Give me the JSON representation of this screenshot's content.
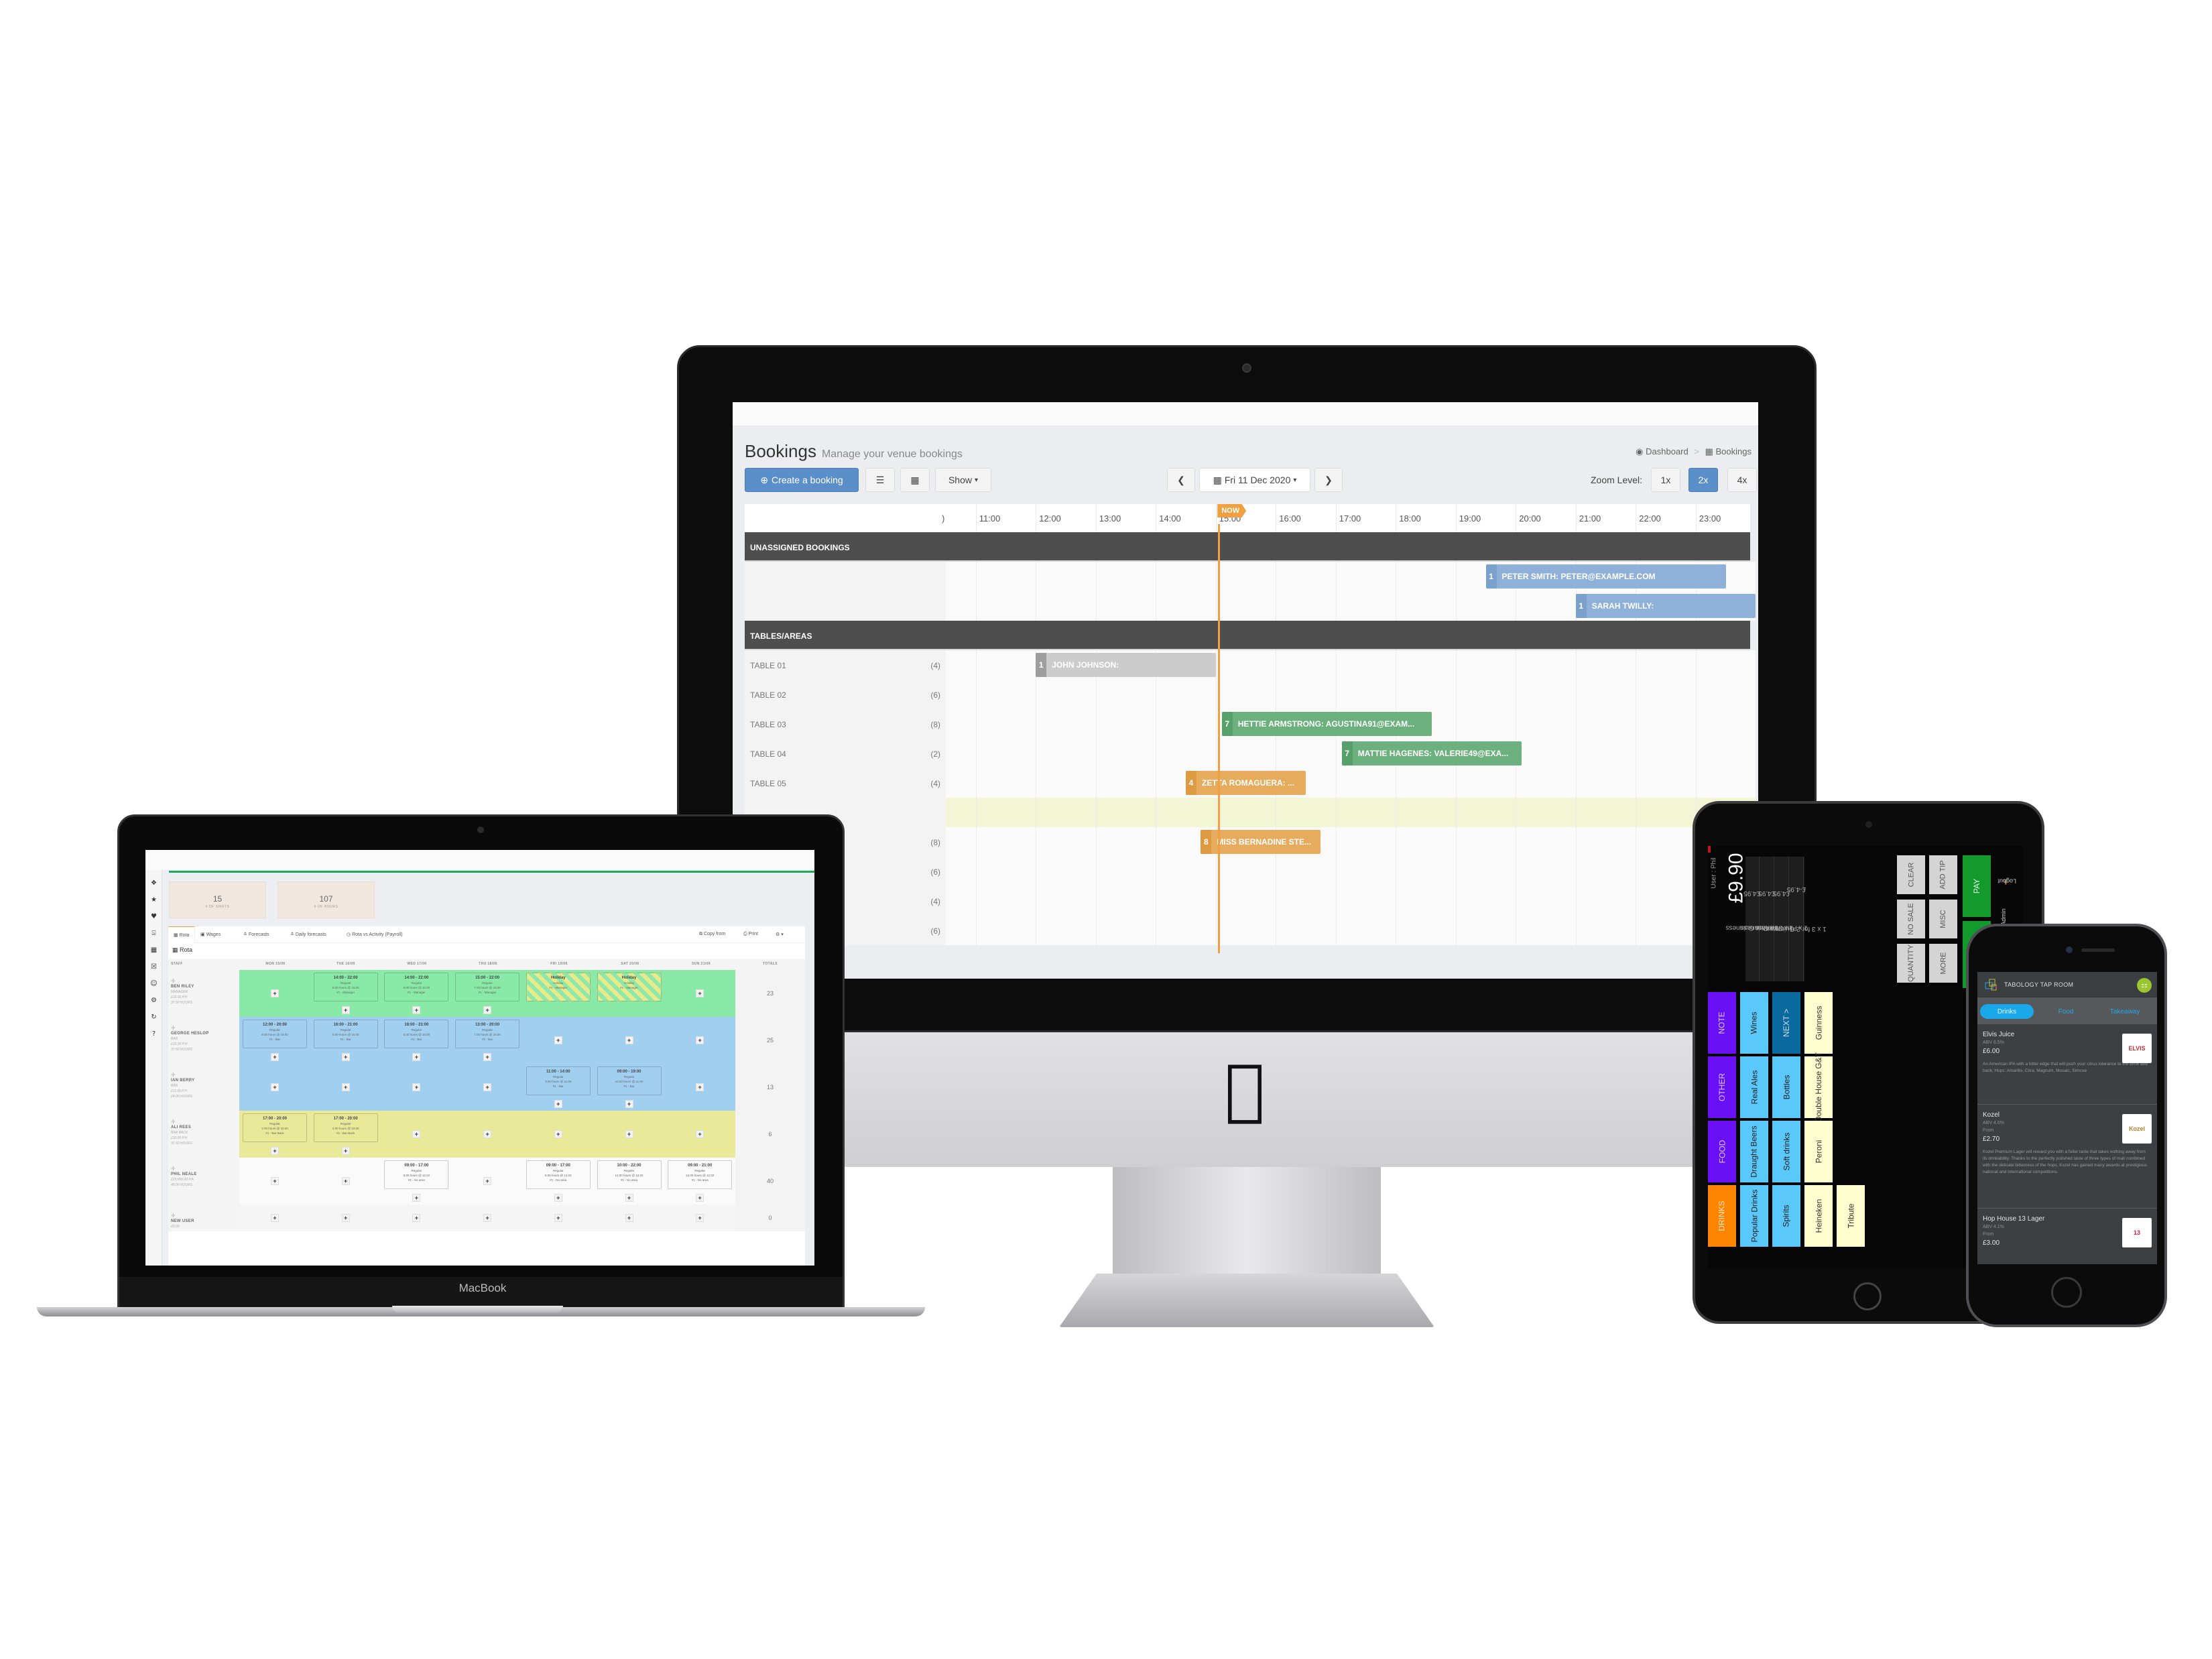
{
  "imac": {
    "logo_icon": "apple-logo-icon",
    "bookings": {
      "title": "Bookings",
      "subtitle": "Manage your venue bookings",
      "breadcrumb": [
        {
          "icon": "dashboard-icon",
          "label": "Dashboard"
        },
        {
          "icon": "calendar-icon",
          "label": "Bookings"
        }
      ],
      "toolbar": {
        "create_label": "Create a booking",
        "list_view_icon": "list-icon",
        "calendar_view_icon": "calendar-icon",
        "show_label": "Show",
        "prev_icon": "chevron-left-icon",
        "date_label": "Fri 11 Dec 2020",
        "next_icon": "chevron-right-icon",
        "zoom_label": "Zoom Level:",
        "zoom_levels": [
          "1x",
          "2x",
          "4x"
        ],
        "zoom_selected": "2x"
      },
      "timeline": {
        "hours": [
          "11:00",
          "12:00",
          "13:00",
          "14:00",
          "15:00",
          "16:00",
          "17:00",
          "18:00",
          "19:00",
          "20:00",
          "21:00",
          "22:00",
          "23:00"
        ],
        "partial_hour_label": ")",
        "now_label": "NOW",
        "now_time": 15.05,
        "sections": [
          {
            "title": "UNASSIGNED BOOKINGS",
            "rows": [
              {
                "label": "",
                "capacity": "",
                "bookings": [
                  {
                    "covers": "1",
                    "name": "PETER SMITH: PETER@EXAMPLE.COM",
                    "start": 19.5,
                    "end": 23.5,
                    "color": "#8fb0d8",
                    "accent": "#7aa0cc"
                  }
                ]
              },
              {
                "label": "",
                "capacity": "",
                "bookings": [
                  {
                    "covers": "1",
                    "name": "SARAH TWILLY:",
                    "start": 21.0,
                    "end": 24.0,
                    "color": "#8fb0d8",
                    "accent": "#7aa0cc"
                  }
                ]
              }
            ]
          },
          {
            "title": "TABLES/AREAS",
            "rows": [
              {
                "label": "TABLE 01",
                "capacity": "(4)",
                "bookings": [
                  {
                    "covers": "1",
                    "name": "JOHN JOHNSON:",
                    "start": 12.0,
                    "end": 15.0,
                    "color": "#cccccc",
                    "accent": "#9e9e9e"
                  }
                ]
              },
              {
                "label": "TABLE 02",
                "capacity": "(6)",
                "bookings": []
              },
              {
                "label": "TABLE 03",
                "capacity": "(8)",
                "bookings": [
                  {
                    "covers": "7",
                    "name": "HETTIE ARMSTRONG: AGUSTINA91@EXAM...",
                    "start": 15.1,
                    "end": 18.6,
                    "color": "#6cb07e",
                    "accent": "#57a06a"
                  }
                ]
              },
              {
                "label": "TABLE 04",
                "capacity": "(2)",
                "bookings": [
                  {
                    "covers": "7",
                    "name": "MATTIE HAGENES: VALERIE49@EXA...",
                    "start": 17.1,
                    "end": 20.1,
                    "color": "#6cb07e",
                    "accent": "#57a06a"
                  }
                ]
              },
              {
                "label": "TABLE 05",
                "capacity": "(4)",
                "bookings": [
                  {
                    "covers": "4",
                    "name": "ZETTA ROMAGUERA: ...",
                    "start": 14.5,
                    "end": 16.5,
                    "color": "#e6ab5c",
                    "accent": "#de9a40"
                  }
                ]
              },
              {
                "label": "",
                "capacity": "",
                "highlight": true,
                "bookings": []
              },
              {
                "label": "",
                "capacity": "(8)",
                "bookings": [
                  {
                    "covers": "8",
                    "name": "MISS BERNADINE STE...",
                    "start": 14.75,
                    "end": 16.75,
                    "color": "#e6ab5c",
                    "accent": "#de9a40"
                  }
                ]
              },
              {
                "label": "",
                "capacity": "(6)",
                "bookings": []
              },
              {
                "label": "",
                "capacity": "(4)",
                "bookings": []
              },
              {
                "label": "",
                "capacity": "(6)",
                "bookings": []
              }
            ]
          }
        ]
      }
    }
  },
  "macbook": {
    "label": "MacBook",
    "sidebar_icons": [
      "cubes-icon",
      "star-icon",
      "heart-icon",
      "sitemap-icon",
      "calendar-icon",
      "calendar-x-icon",
      "users-icon",
      "gear-icon",
      "refresh-icon",
      "help-icon"
    ],
    "stats": [
      {
        "value": "15",
        "label": "# OF SHIFTS"
      },
      {
        "value": "107",
        "label": "# OF HOURS"
      }
    ],
    "tabs": [
      {
        "icon": "calendar-icon",
        "label": "Rota",
        "active": true
      },
      {
        "icon": "money-icon",
        "label": "Wages"
      },
      {
        "icon": "chart-icon",
        "label": "Forecasts"
      },
      {
        "icon": "chart-icon",
        "label": "Daily forecasts"
      },
      {
        "icon": "clock-icon",
        "label": "Rota vs Activity (Payroll)"
      }
    ],
    "tools": [
      {
        "icon": "copy-icon",
        "label": "Copy from"
      },
      {
        "icon": "print-icon",
        "label": "Print"
      },
      {
        "icon": "gear-icon",
        "label": "▾"
      }
    ],
    "heading": "Rota",
    "columns": [
      "STAFF",
      "MON 15/06",
      "TUE 16/06",
      "WED 17/06",
      "THU 18/06",
      "FRI 19/06",
      "SAT 20/06",
      "SUN 21/06",
      "TOTALS"
    ],
    "rows": [
      {
        "name": "BEN RILEY",
        "role": "MANAGER",
        "rate": "£15.00 P.H",
        "hours": "37.50 HOURS",
        "color": "#88eaa6",
        "total": "23",
        "shifts": [
          null,
          {
            "time": "14:00 - 22:00",
            "type": "Regular",
            "detail": "8.00 hours @ 15.00",
            "area": "#1 - Manager"
          },
          {
            "time": "14:00 - 22:00",
            "type": "Regular",
            "detail": "8.00 hours @ 15.00",
            "area": "#1 - Manager"
          },
          {
            "time": "15:00 - 22:00",
            "type": "Regular",
            "detail": "7.00 hours @ 15.00",
            "area": "#1 - Manager"
          },
          {
            "time": "Holiday",
            "type": "Holiday",
            "detail": "",
            "area": "#1 - Manager",
            "holiday": true
          },
          {
            "time": "Holiday",
            "type": "Holiday",
            "detail": "",
            "area": "#1 - Manager",
            "holiday": true
          },
          null
        ]
      },
      {
        "name": "GEORGE HESLOP",
        "role": "BAR",
        "rate": "£15.00 P.H",
        "hours": "37.50 HOURS",
        "color": "#a0cff0",
        "total": "25",
        "shifts": [
          {
            "time": "12:00 - 20:00",
            "type": "Regular",
            "detail": "8.00 hours @ 15.00",
            "area": "#1 - Bar"
          },
          {
            "time": "16:00 - 21:00",
            "type": "Regular",
            "detail": "5.00 hours @ 15.00",
            "area": "#1 - Bar"
          },
          {
            "time": "18:00 - 23:00",
            "type": "Regular",
            "detail": "5.00 hours @ 15.00",
            "area": "#1 - Bar"
          },
          {
            "time": "13:00 - 20:00",
            "type": "Regular",
            "detail": "7.00 hours @ 15.00",
            "area": "#1 - Bar"
          },
          null,
          null,
          null
        ]
      },
      {
        "name": "IAN BERRY",
        "role": "BAR",
        "rate": "£11.00 P.H",
        "hours": "24.00 HOURS",
        "color": "#a0cff0",
        "total": "13",
        "shifts": [
          null,
          null,
          null,
          null,
          {
            "time": "11:00 - 14:00",
            "type": "Regular",
            "detail": "3.00 hours @ 11.00",
            "area": "#1 - Bar"
          },
          {
            "time": "09:00 - 19:00",
            "type": "Regular",
            "detail": "10.00 hours @ 11.00",
            "area": "#1 - Bar"
          },
          null
        ]
      },
      {
        "name": "ALI REES",
        "role": "BAR BACK",
        "rate": "£10.00 P.H",
        "hours": "37.50 HOURS",
        "color": "#e8ea9a",
        "total": "6",
        "shifts": [
          {
            "time": "17:00 - 20:00",
            "type": "Regular",
            "detail": "3.00 hours @ 10.00",
            "area": "#1 - Bar Back"
          },
          {
            "time": "17:00 - 20:00",
            "type": "Regular",
            "detail": "3.00 hours @ 10.00",
            "area": "#1 - Bar Back"
          },
          null,
          null,
          null,
          null,
          null
        ]
      },
      {
        "name": "PHIL NEALE",
        "role": "",
        "rate": "£25,000.00 P.A",
        "hours": "40.00 HOURS",
        "color": "#fafafa",
        "total": "40",
        "shifts": [
          null,
          null,
          {
            "time": "09:00 - 17:00",
            "type": "Regular",
            "detail": "8.00 hours @ 12.02",
            "area": "#1 - No area"
          },
          null,
          {
            "time": "09:00 - 17:00",
            "type": "Regular",
            "detail": "8.00 hours @ 12.02",
            "area": "#1 - No area"
          },
          {
            "time": "10:00 - 22:00",
            "type": "Regular",
            "detail": "12.00 hours @ 12.02",
            "area": "#1 - No area"
          },
          {
            "time": "09:00 - 21:00",
            "type": "Regular",
            "detail": "12.00 hours @ 12.02",
            "area": "#1 - No area"
          }
        ]
      },
      {
        "name": "NEW USER",
        "role": "",
        "rate": "£0.00",
        "hours": "",
        "color": "#f5f5f5",
        "total": "0",
        "shifts": [
          null,
          null,
          null,
          null,
          null,
          null,
          null
        ]
      }
    ]
  },
  "ipad": {
    "user_label": "User : Phil",
    "total": "£9.90",
    "order_lines": [
      {
        "item": "1 x Pint Guinness",
        "price": "£4.95"
      },
      {
        "item": "1 x Pint Guinness",
        "price": "£4.95"
      },
      {
        "item": "1 x Pint Guinness",
        "price": "£4.95"
      },
      {
        "item": "1 x 3 for 2 Guinness",
        "price": "£-4.95"
      }
    ],
    "actions": [
      "CLEAR",
      "ADD TIP",
      "NO SALE",
      "MISC",
      "QUANTITY",
      "MORE"
    ],
    "pay_label": "PAY",
    "logout_label": "Logout",
    "admin_label": "Admin",
    "categories": [
      {
        "label": "NOTE",
        "color": "#6a10f5",
        "text": "#d8c8ff"
      },
      {
        "label": "OTHER",
        "color": "#6a10f5",
        "text": "#d8c8ff"
      },
      {
        "label": "FOOD",
        "color": "#6a10f5",
        "text": "#d8c8ff"
      },
      {
        "label": "DRINKS",
        "color": "#ff8500",
        "text": "#ffe4c4"
      }
    ],
    "groups_col1": [
      {
        "label": "Wines"
      },
      {
        "label": "Real Ales"
      },
      {
        "label": "Draught Beers"
      },
      {
        "label": "Popular Drinks"
      }
    ],
    "groups_col2": [
      {
        "label": "NEXT >",
        "dark": true
      },
      {
        "label": "Bottles"
      },
      {
        "label": "Soft drinks"
      },
      {
        "label": "Spirits"
      }
    ],
    "products_col1": [
      {
        "label": "Guinness"
      },
      {
        "label": "Double House G&T"
      },
      {
        "label": "Peroni"
      },
      {
        "label": "Heineken"
      }
    ],
    "products_col2": [
      {
        "label": "Tribute"
      }
    ]
  },
  "iphone": {
    "venue": "TABOLOGY TAP ROOM",
    "basket_icon": "basket-icon",
    "tabs": [
      "Drinks",
      "Food",
      "Takeaway"
    ],
    "active_tab": "Drinks",
    "items": [
      {
        "name": "Elvis Juice",
        "abv": "ABV 6.5%",
        "from": "",
        "price": "£6.00",
        "desc": "An American IPA with a bitter edge that will push your citrus tolerance to the brink and back; Hops: Amarillo, Citra, Magnum, Mosaic, Simcoe",
        "image": "elvis-juice-can-icon"
      },
      {
        "name": "Kozel",
        "abv": "ABV 4.6%",
        "from": "From",
        "price": "£2.70",
        "desc": "Kozel Premium Lager will reward you with a fuller taste that takes nothing away from its drinkability. Thanks to the perfectly polished taste of three types of malt combined with the delicate bitterness of the hops, Kozel has gained many awards at prestigious national and international competitions.",
        "image": "kozel-logo-icon"
      },
      {
        "name": "Hop House 13 Lager",
        "abv": "ABV 4.1%",
        "from": "From",
        "price": "£3.00",
        "desc": "",
        "image": "hop-house-13-logo-icon"
      }
    ]
  }
}
